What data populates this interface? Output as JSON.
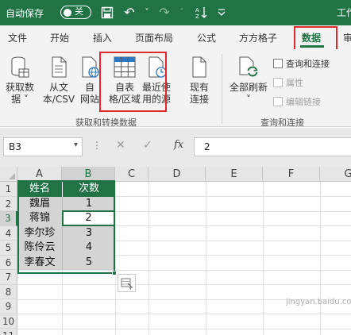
{
  "titlebar": {
    "autosave_label": "自动保存",
    "autosave_state": "关",
    "document_title": "工作"
  },
  "ribbon_tabs": [
    "文件",
    "开始",
    "插入",
    "页面布局",
    "公式",
    "方方格子",
    "数据",
    "审"
  ],
  "active_tab": "数据",
  "groups": {
    "get_transform": {
      "label": "获取和转换数据",
      "buttons": {
        "get_data": [
          "获取数",
          "据 ˅"
        ],
        "from_csv": [
          "从文",
          "本/CSV"
        ],
        "from_web": [
          "自",
          "网站"
        ],
        "from_table": [
          "自表",
          "格/区域"
        ],
        "recent_sources": [
          "最近使",
          "用的源"
        ],
        "existing_conn": [
          "现有",
          "连接"
        ]
      }
    },
    "queries": {
      "label": "查询和连接",
      "refresh_all": [
        "全部刷新",
        "˅"
      ],
      "queries_connections": "查询和连接",
      "properties": "属性",
      "edit_links": "编辑链接"
    }
  },
  "formula_bar": {
    "name_box": "B3",
    "value": "2",
    "fx": "fx"
  },
  "columns": [
    "A",
    "B",
    "C",
    "D",
    "E",
    "F",
    "G"
  ],
  "rows": [
    "1",
    "2",
    "3",
    "4",
    "5",
    "6",
    "7",
    "8",
    "9",
    "10",
    "11",
    "12"
  ],
  "table": {
    "headers": [
      "姓名",
      "次数"
    ],
    "rows": [
      [
        "魏眉",
        "1"
      ],
      [
        "蒋锦",
        "2"
      ],
      [
        "李尔珍",
        "3"
      ],
      [
        "陈伶云",
        "4"
      ],
      [
        "李春文",
        "5"
      ]
    ]
  },
  "watermark": "jingyan.baidu.com",
  "colors": {
    "accent": "#217346",
    "highlight_box": "#e0282d"
  }
}
